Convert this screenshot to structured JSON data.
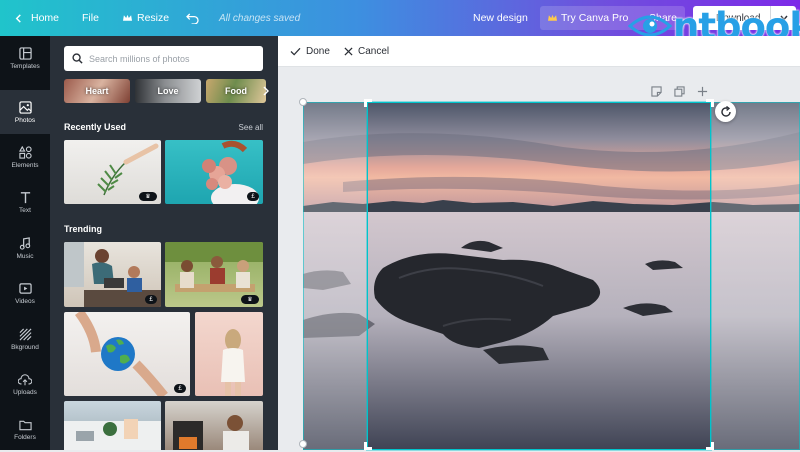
{
  "topbar": {
    "home": "Home",
    "file": "File",
    "resize": "Resize",
    "status": "All changes saved",
    "new_design": "New design",
    "try_pro": "Try Canva Pro",
    "share": "Share",
    "download": "Download"
  },
  "brand": {
    "text": "ntbook"
  },
  "nav": {
    "items": [
      {
        "label": "Templates",
        "icon": "templates-icon"
      },
      {
        "label": "Photos",
        "icon": "photos-icon"
      },
      {
        "label": "Elements",
        "icon": "elements-icon"
      },
      {
        "label": "Text",
        "icon": "text-icon"
      },
      {
        "label": "Music",
        "icon": "music-icon"
      },
      {
        "label": "Videos",
        "icon": "videos-icon"
      },
      {
        "label": "Bkground",
        "icon": "background-icon"
      },
      {
        "label": "Uploads",
        "icon": "uploads-icon"
      },
      {
        "label": "Folders",
        "icon": "folders-icon"
      }
    ],
    "active": "Photos"
  },
  "panel": {
    "search_placeholder": "Search millions of photos",
    "chips": [
      "Heart",
      "Love",
      "Food"
    ],
    "recently_used": "Recently Used",
    "see_all": "See all",
    "trending": "Trending",
    "badge_free_symbol": "£",
    "badge_crown_symbol": "♛"
  },
  "editbar": {
    "done": "Done",
    "cancel": "Cancel"
  },
  "colors": {
    "accent": "#00c4cc",
    "topbar_start": "#20c4cb",
    "topbar_end": "#7d2ae8",
    "sidebar": "#0e1318",
    "panel": "#293039",
    "brand": "#27a0e6"
  }
}
